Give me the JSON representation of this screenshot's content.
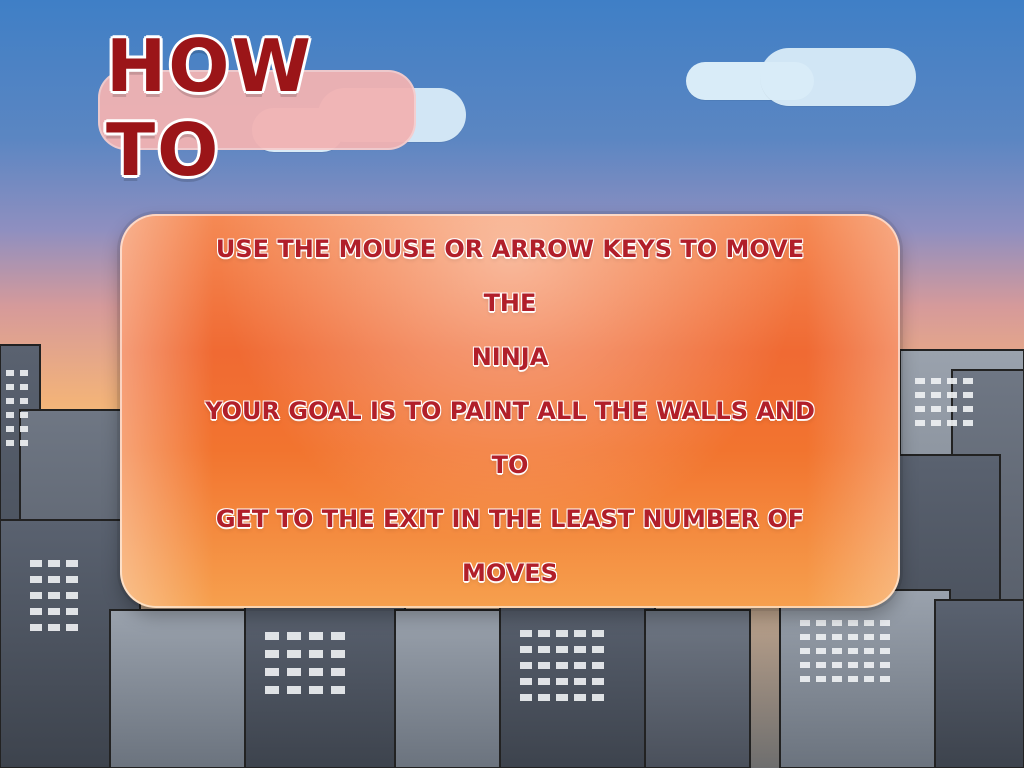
{
  "screen": {
    "title": "HOW TO",
    "instructions": [
      "USE THE MOUSE OR ARROW KEYS TO MOVE THE",
      "NINJA",
      "YOUR GOAL IS TO PAINT ALL THE WALLS AND TO",
      "GET TO THE EXIT IN THE LEAST NUMBER OF",
      "MOVES"
    ]
  },
  "icons": {
    "background": "city-skyline-illustration",
    "title_plate": "title-plate-icon"
  },
  "colors": {
    "sky_top": "#3f7fc6",
    "sunset": "#f8c97c",
    "panel_orange": "#f06a33",
    "title_red": "#9b1518",
    "text_red": "#b11f2a",
    "title_plate_pink": "#f2b3b3",
    "cloud": "#d9ecf8"
  }
}
